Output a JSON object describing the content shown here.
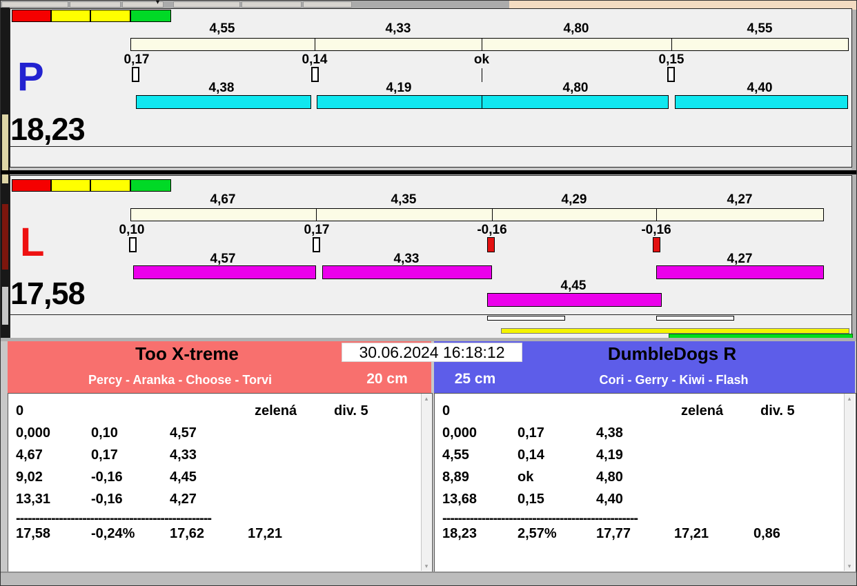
{
  "timestamp": "30.06.2024 16:18:12",
  "icons": {
    "caret_down": "▾",
    "scroll_up": "▴",
    "scroll_down": "▾"
  },
  "panel_p": {
    "letter": "P",
    "total": "18,23",
    "upper_times": [
      "4,55",
      "4,33",
      "4,80",
      "4,55"
    ],
    "faults": [
      "0,17",
      "0,14",
      "ok",
      "0,15"
    ],
    "lower_times": [
      "4,38",
      "4,19",
      "4,80",
      "4,40"
    ],
    "colors": {
      "letter": "#2222d0",
      "upper_bar": "#fcfce6",
      "lower_bar": "#10e7ef"
    }
  },
  "panel_l": {
    "letter": "L",
    "total": "17,58",
    "upper_times": [
      "4,67",
      "4,35",
      "4,29",
      "4,27"
    ],
    "faults": [
      "0,10",
      "0,17",
      "-0,16",
      "-0,16"
    ],
    "lower_times": [
      "4,57",
      "4,33",
      "4,27"
    ],
    "extra_time": "4,45",
    "colors": {
      "letter": "#ee1111",
      "upper_bar": "#fcfce6",
      "lower_bar": "#eb00eb"
    }
  },
  "traffic_lights": [
    "#f50000",
    "#ffff00",
    "#ffff00",
    "#00d926"
  ],
  "progress_bars": {
    "yellow": "#f4f400",
    "green": "#00dd1c"
  },
  "teams": {
    "left": {
      "name": "Too X-treme",
      "members": "Percy - Aranka - Choose - Torvi",
      "height": "20 cm",
      "header_color": "#f8706e",
      "info_row": {
        "c1": "0",
        "c4": "zelená",
        "c5": "div. 5"
      },
      "rows": [
        {
          "c1": "0,000",
          "c2": "0,10",
          "c3": "4,57"
        },
        {
          "c1": "4,67",
          "c2": "0,17",
          "c3": "4,33"
        },
        {
          "c1": "9,02",
          "c2": "-0,16",
          "c3": "4,45"
        },
        {
          "c1": "13,31",
          "c2": "-0,16",
          "c3": "4,27"
        }
      ],
      "separator": "--------------------------------------------------",
      "total_row": {
        "c1": "17,58",
        "c2": "-0,24%",
        "c3": "17,62",
        "c4": "17,21",
        "c5": ""
      }
    },
    "right": {
      "name": "DumbleDogs R",
      "members": "Cori - Gerry - Kiwi - Flash",
      "height": "25 cm",
      "header_color": "#5d5de9",
      "info_row": {
        "c1": "0",
        "c4": "zelená",
        "c5": "div. 5"
      },
      "rows": [
        {
          "c1": "0,000",
          "c2": "0,17",
          "c3": "4,38"
        },
        {
          "c1": "4,55",
          "c2": "0,14",
          "c3": "4,19"
        },
        {
          "c1": "8,89",
          "c2": "ok",
          "c3": "4,80"
        },
        {
          "c1": "13,68",
          "c2": "0,15",
          "c3": "4,40"
        }
      ],
      "separator": "--------------------------------------------------",
      "total_row": {
        "c1": "18,23",
        "c2": "2,57%",
        "c3": "17,77",
        "c4": "17,21",
        "c5": "0,86"
      }
    }
  }
}
